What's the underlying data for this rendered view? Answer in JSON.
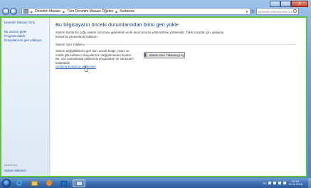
{
  "window": {
    "caption_buttons": [
      "_",
      "□",
      "X"
    ]
  },
  "address": {
    "crumbs": [
      "Denetim Masası",
      "Tüm Denetim Masası Öğeleri",
      "Kurtarma"
    ],
    "search_placeholder": "Denetim Masasında Ara"
  },
  "sidebar": {
    "home": "Denetim Masası Giriş",
    "items": [
      "Bir sorunu gider",
      "Program kaldır",
      "Dosyalarınızı geri yükleyin"
    ],
    "see_also": "Ayrıca bkz.",
    "backup": "Sistem Merkezi"
  },
  "main": {
    "title": "Bu bilgisayarın önceki durumlarından birini geri yükle",
    "intro": "Sistem Kurtarma çoğu sistem sorununu giderebilir ve ilk durumunuza yönlendirme yöntemidir. Ciddi sorunlar için, gelişmiş kurtarma yöntemlerini kullanın.",
    "section_heading": "Sistem Geri Yükleme",
    "section_body": "Sistem değişikliklerini geri alın, ancak belge, resim ve müzik gibi kullanıcı dosyalarınızı değiştirmeden bırakın. Bu, son zamanlarda yüklenmiş programları ve sürücüleri kaldırabilir.",
    "restore_button": "Sistem Geri Yüklemeyi Aç",
    "advanced_link": "Gelişmiş kurtarma yöntemleri"
  },
  "taskbar": {
    "language": "TR",
    "time": "09:18",
    "date": "19.11.2018"
  },
  "colors": {
    "content_border": "#5ec43a",
    "link": "#1e5db8",
    "title": "#1e3e78"
  }
}
